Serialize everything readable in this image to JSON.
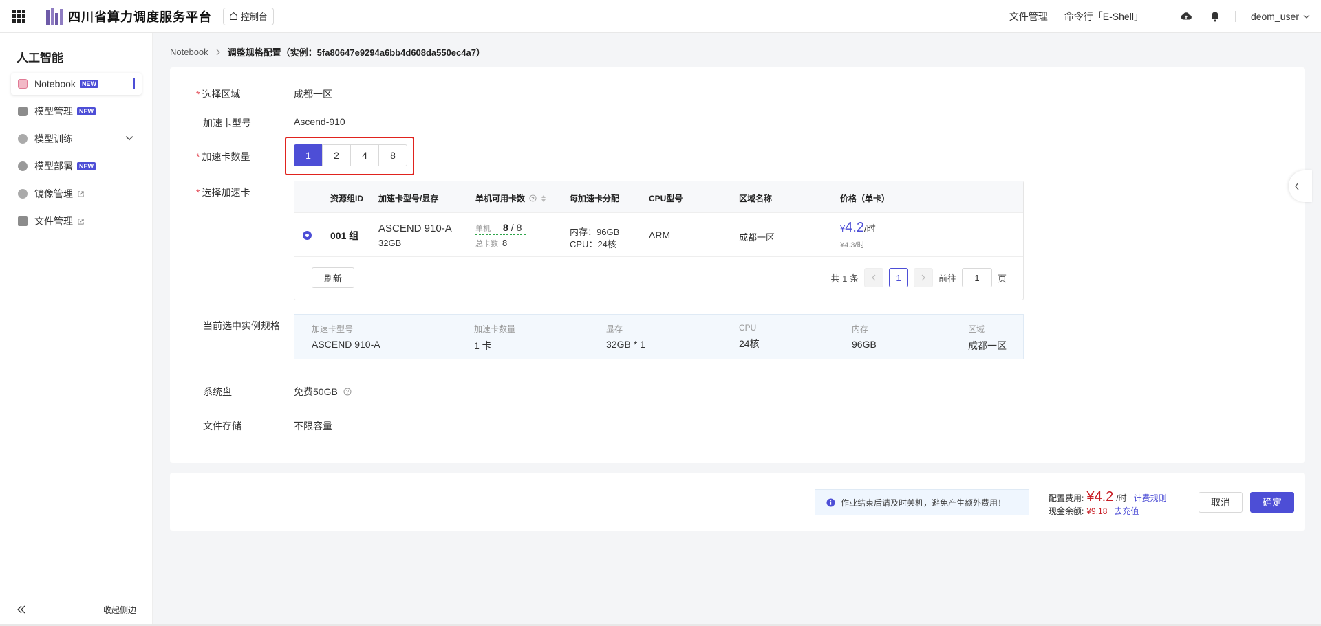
{
  "topbar": {
    "brand": "四川省算力调度服务平台",
    "console": "控制台",
    "links": [
      "文件管理",
      "命令行「E-Shell」"
    ],
    "user": "deom_user"
  },
  "sidebar": {
    "title": "人工智能",
    "items": [
      {
        "label": "Notebook",
        "badge": "NEW"
      },
      {
        "label": "模型管理",
        "badge": "NEW"
      },
      {
        "label": "模型训练"
      },
      {
        "label": "模型部署",
        "badge": "NEW"
      },
      {
        "label": "镜像管理"
      },
      {
        "label": "文件管理"
      }
    ],
    "collapse": "收起侧边"
  },
  "breadcrumb": {
    "root": "Notebook",
    "current": "调整规格配置（实例：5fa80647e9294a6bb4d608da550ec4a7）"
  },
  "form": {
    "region_label": "选择区域",
    "region_value": "成都一区",
    "card_type_label": "加速卡型号",
    "card_type_value": "Ascend-910",
    "count_label": "加速卡数量",
    "counts": [
      "1",
      "2",
      "4",
      "8"
    ],
    "selected_count": "1",
    "select_card_label": "选择加速卡",
    "spec_label": "当前选中实例规格",
    "disk_label": "系统盘",
    "disk_value": "免费50GB",
    "storage_label": "文件存储",
    "storage_value": "不限容量"
  },
  "table": {
    "headers": [
      "资源组ID",
      "加速卡型号/显存",
      "单机可用卡数",
      "每加速卡分配",
      "CPU型号",
      "区域名称",
      "价格（单卡）"
    ],
    "row": {
      "group": "001 组",
      "card_model": "ASCEND 910-A",
      "card_mem": "32GB",
      "avail_label": "单机",
      "avail_value": "8",
      "avail_total_sep": "/ 8",
      "total_label": "总卡数",
      "total_value": "8",
      "mem_alloc": "内存：96GB",
      "cpu_alloc": "CPU：24核",
      "cpu_model": "ARM",
      "region": "成都一区",
      "price_symbol": "¥",
      "price": "4.2",
      "price_unit": "/时",
      "old_price": "¥4.3/时"
    },
    "refresh": "刷新",
    "pager": {
      "total": "共 1 条",
      "page": "1",
      "goto": "前往",
      "goto_value": "1",
      "unit": "页"
    }
  },
  "spec": [
    {
      "k": "加速卡型号",
      "v": "ASCEND 910-A"
    },
    {
      "k": "加速卡数量",
      "v": "1 卡"
    },
    {
      "k": "显存",
      "v": "32GB * 1"
    },
    {
      "k": "CPU",
      "v": "24核"
    },
    {
      "k": "内存",
      "v": "96GB"
    },
    {
      "k": "区域",
      "v": "成都一区"
    }
  ],
  "footer": {
    "notice": "作业结束后请及时关机，避免产生额外费用！",
    "fee_label": "配置费用:",
    "fee_price": "¥4.2",
    "fee_unit": "/时",
    "fee_rule": "计费规则",
    "balance_label": "现金余额:",
    "balance_value": "¥9.18",
    "recharge": "去充值",
    "cancel": "取消",
    "confirm": "确定"
  },
  "colors": {
    "primary": "#4d4ed6",
    "price": "#c81d25",
    "highlight_border": "#e0231e"
  }
}
